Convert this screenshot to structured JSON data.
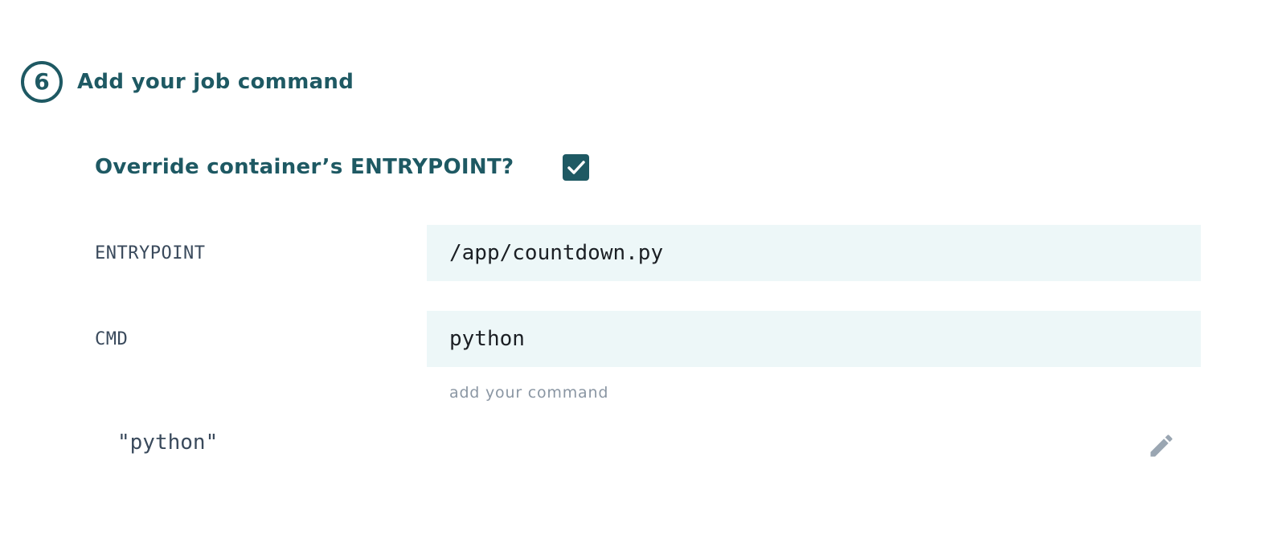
{
  "step": {
    "number": "6",
    "title": "Add your job command"
  },
  "override": {
    "label": "Override container’s ENTRYPOINT?",
    "checked": true
  },
  "entrypoint": {
    "label": "ENTRYPOINT",
    "value": "/app/countdown.py"
  },
  "cmd": {
    "label": "CMD",
    "value": "python",
    "hint": "add your command",
    "preview": "\"python\""
  },
  "icons": {
    "checkbox": "check-icon",
    "edit": "pencil-icon"
  },
  "colors": {
    "accent": "#1e5963",
    "input_background": "#edf7f8",
    "muted_text": "#8a96a3",
    "edit_icon": "#9aa6b2"
  }
}
